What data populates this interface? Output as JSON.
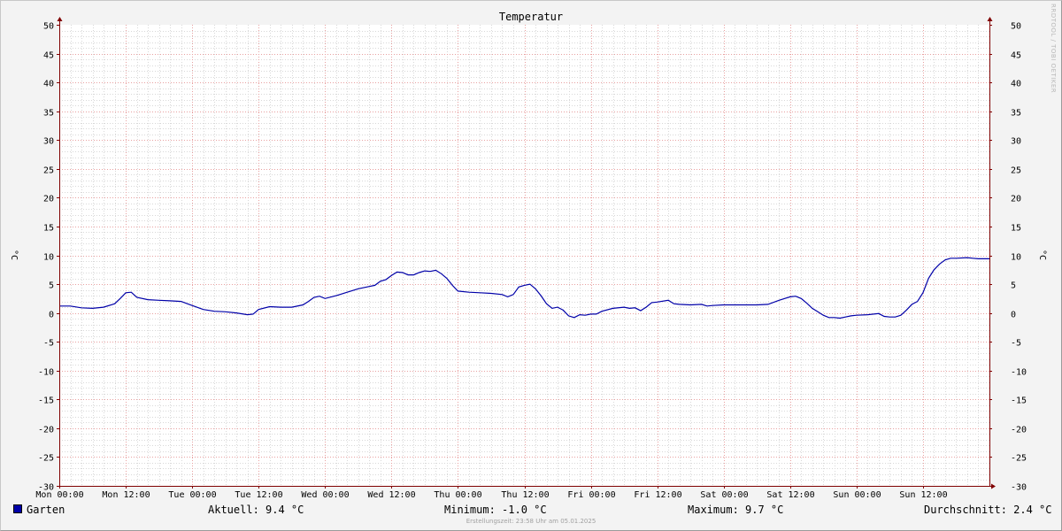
{
  "chart_data": {
    "type": "line",
    "title": "Temperatur",
    "ylabel": "°C",
    "ylim": [
      -30,
      50
    ],
    "yticks": [
      50,
      45,
      40,
      35,
      30,
      25,
      20,
      15,
      10,
      5,
      0,
      -5,
      -10,
      -15,
      -20,
      -25,
      -30
    ],
    "xlim_hours": [
      0,
      168
    ],
    "xticks": [
      {
        "h": 0,
        "label": "Mon 00:00"
      },
      {
        "h": 12,
        "label": "Mon 12:00"
      },
      {
        "h": 24,
        "label": "Tue 00:00"
      },
      {
        "h": 36,
        "label": "Tue 12:00"
      },
      {
        "h": 48,
        "label": "Wed 00:00"
      },
      {
        "h": 60,
        "label": "Wed 12:00"
      },
      {
        "h": 72,
        "label": "Thu 00:00"
      },
      {
        "h": 84,
        "label": "Thu 12:00"
      },
      {
        "h": 96,
        "label": "Fri 00:00"
      },
      {
        "h": 108,
        "label": "Fri 12:00"
      },
      {
        "h": 120,
        "label": "Sat 00:00"
      },
      {
        "h": 132,
        "label": "Sat 12:00"
      },
      {
        "h": 144,
        "label": "Sun 00:00"
      },
      {
        "h": 156,
        "label": "Sun 12:00"
      }
    ],
    "grid": true,
    "colors": {
      "line": "#0000a8",
      "grid_major": "#e8a0a0",
      "grid_minor": "#d8d8d8",
      "axis": "#800000"
    },
    "series": [
      {
        "name": "Garten",
        "points": [
          [
            0,
            1.2
          ],
          [
            2,
            1.2
          ],
          [
            4,
            0.9
          ],
          [
            6,
            0.8
          ],
          [
            8,
            1.0
          ],
          [
            10,
            1.6
          ],
          [
            11,
            2.5
          ],
          [
            12,
            3.5
          ],
          [
            13,
            3.6
          ],
          [
            14,
            2.7
          ],
          [
            16,
            2.3
          ],
          [
            18,
            2.2
          ],
          [
            20,
            2.1
          ],
          [
            22,
            2.0
          ],
          [
            24,
            1.3
          ],
          [
            26,
            0.6
          ],
          [
            28,
            0.3
          ],
          [
            30,
            0.2
          ],
          [
            32,
            0.0
          ],
          [
            34,
            -0.3
          ],
          [
            35,
            -0.2
          ],
          [
            36,
            0.6
          ],
          [
            38,
            1.1
          ],
          [
            40,
            1.0
          ],
          [
            42,
            1.0
          ],
          [
            44,
            1.4
          ],
          [
            45,
            2.0
          ],
          [
            46,
            2.7
          ],
          [
            47,
            2.9
          ],
          [
            48,
            2.5
          ],
          [
            50,
            3.0
          ],
          [
            52,
            3.6
          ],
          [
            54,
            4.2
          ],
          [
            56,
            4.6
          ],
          [
            57,
            4.8
          ],
          [
            58,
            5.5
          ],
          [
            59,
            5.8
          ],
          [
            60,
            6.5
          ],
          [
            61,
            7.1
          ],
          [
            62,
            7.0
          ],
          [
            63,
            6.6
          ],
          [
            64,
            6.6
          ],
          [
            65,
            7.0
          ],
          [
            66,
            7.3
          ],
          [
            67,
            7.2
          ],
          [
            68,
            7.4
          ],
          [
            69,
            6.8
          ],
          [
            70,
            6.0
          ],
          [
            71,
            4.8
          ],
          [
            72,
            3.8
          ],
          [
            74,
            3.6
          ],
          [
            76,
            3.5
          ],
          [
            78,
            3.4
          ],
          [
            80,
            3.2
          ],
          [
            81,
            2.8
          ],
          [
            82,
            3.2
          ],
          [
            83,
            4.5
          ],
          [
            84,
            4.8
          ],
          [
            85,
            5.0
          ],
          [
            86,
            4.2
          ],
          [
            87,
            3.0
          ],
          [
            88,
            1.6
          ],
          [
            89,
            0.8
          ],
          [
            90,
            1.0
          ],
          [
            91,
            0.5
          ],
          [
            92,
            -0.5
          ],
          [
            93,
            -0.8
          ],
          [
            94,
            -0.3
          ],
          [
            95,
            -0.4
          ],
          [
            96,
            -0.2
          ],
          [
            97,
            -0.2
          ],
          [
            98,
            0.3
          ],
          [
            100,
            0.8
          ],
          [
            102,
            1.0
          ],
          [
            103,
            0.8
          ],
          [
            104,
            0.9
          ],
          [
            105,
            0.4
          ],
          [
            106,
            1.0
          ],
          [
            107,
            1.8
          ],
          [
            108,
            1.9
          ],
          [
            110,
            2.2
          ],
          [
            111,
            1.6
          ],
          [
            112,
            1.5
          ],
          [
            114,
            1.4
          ],
          [
            116,
            1.5
          ],
          [
            117,
            1.2
          ],
          [
            118,
            1.3
          ],
          [
            120,
            1.4
          ],
          [
            122,
            1.4
          ],
          [
            124,
            1.4
          ],
          [
            126,
            1.4
          ],
          [
            128,
            1.5
          ],
          [
            130,
            2.2
          ],
          [
            132,
            2.8
          ],
          [
            133,
            2.9
          ],
          [
            134,
            2.5
          ],
          [
            135,
            1.7
          ],
          [
            136,
            0.8
          ],
          [
            137,
            0.2
          ],
          [
            138,
            -0.4
          ],
          [
            139,
            -0.8
          ],
          [
            140,
            -0.8
          ],
          [
            141,
            -0.9
          ],
          [
            142,
            -0.7
          ],
          [
            143,
            -0.5
          ],
          [
            144,
            -0.4
          ],
          [
            146,
            -0.3
          ],
          [
            148,
            -0.1
          ],
          [
            149,
            -0.6
          ],
          [
            150,
            -0.7
          ],
          [
            151,
            -0.7
          ],
          [
            152,
            -0.4
          ],
          [
            153,
            0.5
          ],
          [
            154,
            1.5
          ],
          [
            155,
            2.0
          ],
          [
            156,
            3.5
          ],
          [
            157,
            6.0
          ],
          [
            158,
            7.5
          ],
          [
            159,
            8.5
          ],
          [
            160,
            9.2
          ],
          [
            161,
            9.5
          ],
          [
            162,
            9.5
          ],
          [
            164,
            9.6
          ],
          [
            165,
            9.5
          ],
          [
            166,
            9.4
          ],
          [
            168,
            9.4
          ]
        ]
      }
    ]
  },
  "legend": {
    "series_name": "Garten",
    "current": "Aktuell: 9.4 °C",
    "minimum": "Minimum: -1.0 °C",
    "maximum": "Maximum: 9.7 °C",
    "average": "Durchschnitt: 2.4 °C"
  },
  "footer": "Erstellungszeit: 23:58 Uhr am 05.01.2025",
  "watermark": "RRDTOOL / TOBI OETIKER"
}
